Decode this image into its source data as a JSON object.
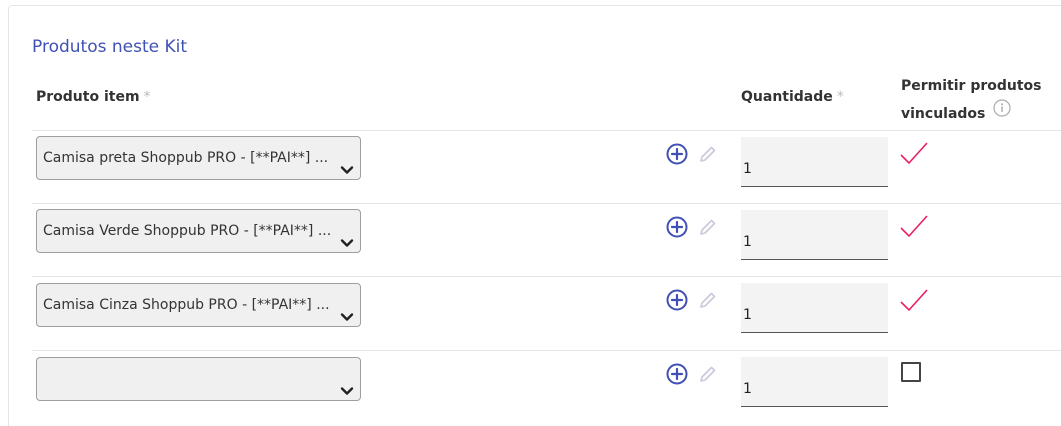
{
  "section": {
    "title": "Produtos neste Kit"
  },
  "headers": {
    "product": "Produto item",
    "quantity": "Quantidade",
    "permit": "Permitir produtos vinculados",
    "required_mark": "*"
  },
  "rows": [
    {
      "product": "Camisa preta Shoppub PRO - [**PAI**] ...",
      "quantity": "1",
      "allow_linked": true
    },
    {
      "product": "Camisa Verde Shoppub PRO - [**PAI**] ...",
      "quantity": "1",
      "allow_linked": true
    },
    {
      "product": "Camisa Cinza Shoppub PRO - [**PAI**] ...",
      "quantity": "1",
      "allow_linked": true
    },
    {
      "product": "",
      "quantity": "1",
      "allow_linked": false
    }
  ],
  "colors": {
    "accent": "#3f51b5",
    "check": "#e91e63"
  }
}
